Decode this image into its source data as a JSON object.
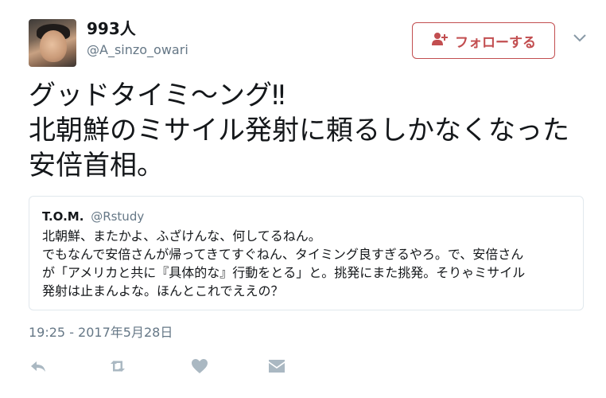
{
  "author": {
    "display_name": "993人",
    "screen_name": "@A_sinzo_owari"
  },
  "follow_button": {
    "label": "フォローする",
    "icon": "user-plus-icon",
    "color": "#c24e50"
  },
  "tweet": {
    "text": "グッドタイミ〜ング‼︎\n北朝鮮のミサイル発射に頼るしかなくなった\n安倍首相。",
    "timestamp": "19:25 - 2017年5月28日"
  },
  "quoted_tweet": {
    "name": "T.O.M.",
    "handle": "@Rstudy",
    "text": "北朝鮮、またかよ、ふざけんな、何してるねん。\nでもなんで安倍さんが帰ってきてすぐねん、タイミング良すぎるやろ。で、安倍さん\nが「アメリカと共に『具体的な』行動をとる」と。挑発にまた挑発。そりゃミサイル\n発射は止まんよな。ほんとこれでええの？"
  },
  "actions": {
    "icons": [
      "reply-icon",
      "retweet-icon",
      "like-icon",
      "direct-message-icon"
    ],
    "color": "#aab8c2"
  }
}
